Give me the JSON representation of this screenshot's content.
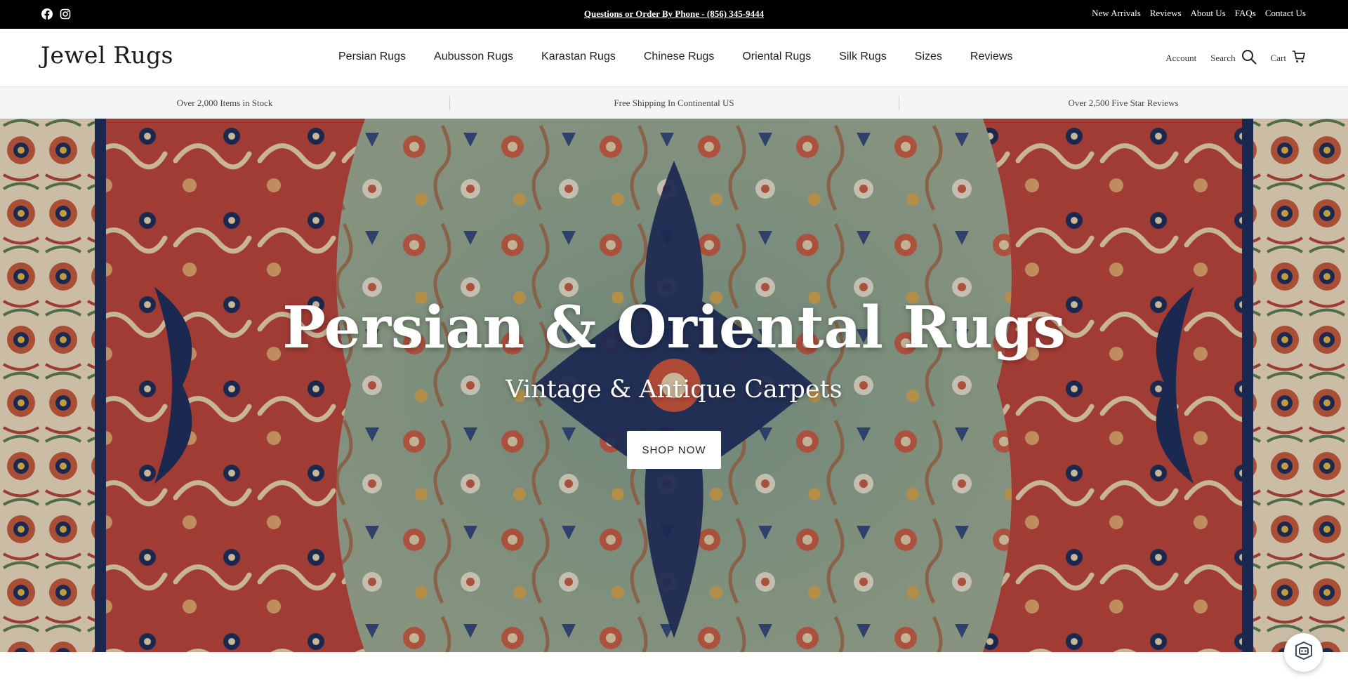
{
  "announcement": {
    "phone_text": "Questions or Order By Phone - (856) 345-9444",
    "social_icons": [
      "facebook-icon",
      "instagram-icon"
    ],
    "links": [
      "New Arrivals",
      "Reviews",
      "About Us",
      "FAQs",
      "Contact Us"
    ]
  },
  "header": {
    "logo": "Jewel Rugs",
    "nav": [
      "Persian Rugs",
      "Aubusson Rugs",
      "Karastan Rugs",
      "Chinese Rugs",
      "Oriental Rugs",
      "Silk Rugs",
      "Sizes",
      "Reviews"
    ],
    "account_label": "Account",
    "search_label": "Search",
    "cart_label": "Cart"
  },
  "usps": [
    "Over 2,000 Items in Stock",
    "Free Shipping In Continental US",
    "Over 2,500 Five Star Reviews"
  ],
  "hero": {
    "title": "Persian & Oriental Rugs",
    "subtitle": "Vintage & Antique Carpets",
    "cta_label": "SHOP NOW"
  },
  "colors": {
    "topbar_bg": "#000000",
    "usp_bg": "#f4f5f6",
    "rug_red": "#b8453d",
    "rug_field": "#8e9f86",
    "rug_navy": "#1f2e5c",
    "rug_cream": "#eadcc2"
  }
}
